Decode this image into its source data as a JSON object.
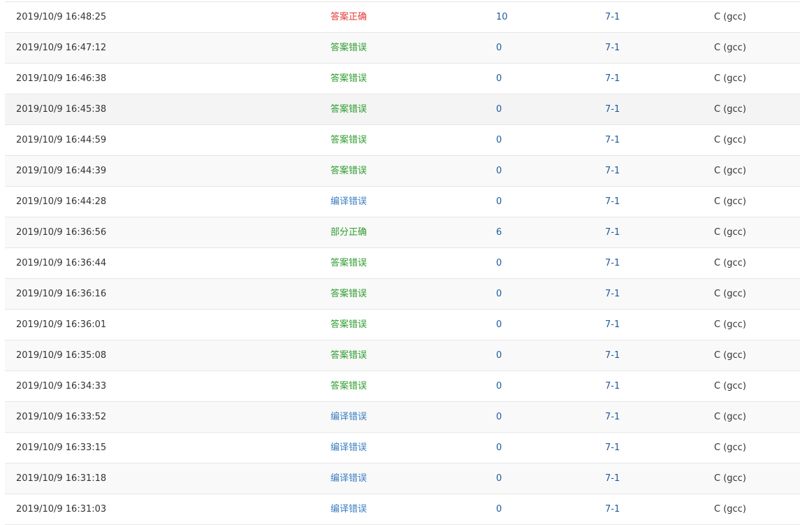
{
  "colors": {
    "accepted": "#e53935",
    "wrong_answer": "#2e9c2e",
    "partial": "#2e9c2e",
    "compile_error": "#3b7ec2",
    "link": "#1e5a9c"
  },
  "submissions": [
    {
      "time": "2019/10/9 16:48:25",
      "status": "答案正确",
      "status_type": "accepted",
      "score": "10",
      "problem": "7-1",
      "language": "C (gcc)"
    },
    {
      "time": "2019/10/9 16:47:12",
      "status": "答案错误",
      "status_type": "wrong",
      "score": "0",
      "problem": "7-1",
      "language": "C (gcc)"
    },
    {
      "time": "2019/10/9 16:46:38",
      "status": "答案错误",
      "status_type": "wrong",
      "score": "0",
      "problem": "7-1",
      "language": "C (gcc)"
    },
    {
      "time": "2019/10/9 16:45:38",
      "status": "答案错误",
      "status_type": "wrong",
      "score": "0",
      "problem": "7-1",
      "language": "C (gcc)"
    },
    {
      "time": "2019/10/9 16:44:59",
      "status": "答案错误",
      "status_type": "wrong",
      "score": "0",
      "problem": "7-1",
      "language": "C (gcc)"
    },
    {
      "time": "2019/10/9 16:44:39",
      "status": "答案错误",
      "status_type": "wrong",
      "score": "0",
      "problem": "7-1",
      "language": "C (gcc)"
    },
    {
      "time": "2019/10/9 16:44:28",
      "status": "编译错误",
      "status_type": "compile",
      "score": "0",
      "problem": "7-1",
      "language": "C (gcc)"
    },
    {
      "time": "2019/10/9 16:36:56",
      "status": "部分正确",
      "status_type": "partial",
      "score": "6",
      "problem": "7-1",
      "language": "C (gcc)"
    },
    {
      "time": "2019/10/9 16:36:44",
      "status": "答案错误",
      "status_type": "wrong",
      "score": "0",
      "problem": "7-1",
      "language": "C (gcc)"
    },
    {
      "time": "2019/10/9 16:36:16",
      "status": "答案错误",
      "status_type": "wrong",
      "score": "0",
      "problem": "7-1",
      "language": "C (gcc)"
    },
    {
      "time": "2019/10/9 16:36:01",
      "status": "答案错误",
      "status_type": "wrong",
      "score": "0",
      "problem": "7-1",
      "language": "C (gcc)"
    },
    {
      "time": "2019/10/9 16:35:08",
      "status": "答案错误",
      "status_type": "wrong",
      "score": "0",
      "problem": "7-1",
      "language": "C (gcc)"
    },
    {
      "time": "2019/10/9 16:34:33",
      "status": "答案错误",
      "status_type": "wrong",
      "score": "0",
      "problem": "7-1",
      "language": "C (gcc)"
    },
    {
      "time": "2019/10/9 16:33:52",
      "status": "编译错误",
      "status_type": "compile",
      "score": "0",
      "problem": "7-1",
      "language": "C (gcc)"
    },
    {
      "time": "2019/10/9 16:33:15",
      "status": "编译错误",
      "status_type": "compile",
      "score": "0",
      "problem": "7-1",
      "language": "C (gcc)"
    },
    {
      "time": "2019/10/9 16:31:18",
      "status": "编译错误",
      "status_type": "compile",
      "score": "0",
      "problem": "7-1",
      "language": "C (gcc)"
    },
    {
      "time": "2019/10/9 16:31:03",
      "status": "编译错误",
      "status_type": "compile",
      "score": "0",
      "problem": "7-1",
      "language": "C (gcc)"
    }
  ]
}
